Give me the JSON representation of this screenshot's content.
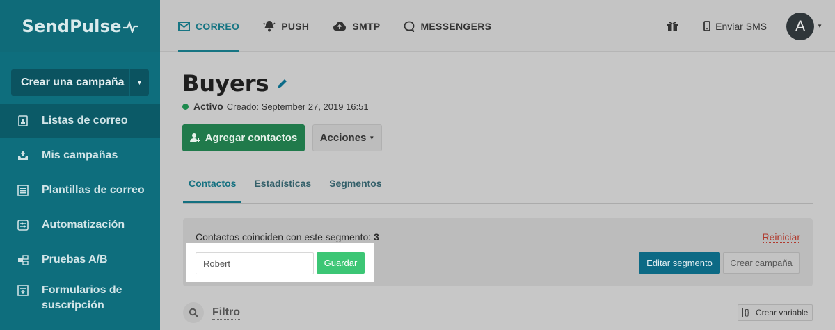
{
  "app": {
    "logo": "SendPulse"
  },
  "sidebar": {
    "create_button": "Crear una campaña",
    "items": [
      {
        "label": "Listas de correo",
        "icon": "address-book-icon",
        "active": true
      },
      {
        "label": "Mis campañas",
        "icon": "inbox-upload-icon"
      },
      {
        "label": "Plantillas de correo",
        "icon": "template-icon"
      },
      {
        "label": "Automatización",
        "icon": "automation-icon"
      },
      {
        "label": "Pruebas A/B",
        "icon": "ab-test-icon"
      },
      {
        "label": "Formularios de suscripción",
        "icon": "form-icon"
      }
    ]
  },
  "topnav": {
    "tabs": [
      {
        "label": "CORREO",
        "icon": "envelope-icon",
        "active": true
      },
      {
        "label": "PUSH",
        "icon": "bell-icon"
      },
      {
        "label": "SMTP",
        "icon": "cloud-upload-icon"
      },
      {
        "label": "MESSENGERS",
        "icon": "chat-icon"
      }
    ],
    "sms_label": "Enviar SMS",
    "avatar_letter": "A"
  },
  "page": {
    "title": "Buyers",
    "status": "Activo",
    "created": "Creado: September 27, 2019 16:51",
    "add_contacts": "Agregar contactos",
    "actions": "Acciones",
    "tabs": [
      {
        "label": "Contactos",
        "active": true
      },
      {
        "label": "Estadísticas"
      },
      {
        "label": "Segmentos"
      }
    ]
  },
  "segment": {
    "match_text": "Contactos coinciden con este segmento:",
    "match_count": "3",
    "reset": "Reiniciar",
    "name_value": "Robert",
    "save": "Guardar",
    "edit_segment": "Editar segmento",
    "create_campaign": "Crear campaña"
  },
  "filter": {
    "label": "Filtro",
    "create_variable": "Crear variable"
  },
  "colors": {
    "sidebar": "#0e6e7d",
    "accent": "#177583",
    "green": "#207a4b",
    "save_green": "#3cc675",
    "reset_red": "#b03a2e"
  }
}
